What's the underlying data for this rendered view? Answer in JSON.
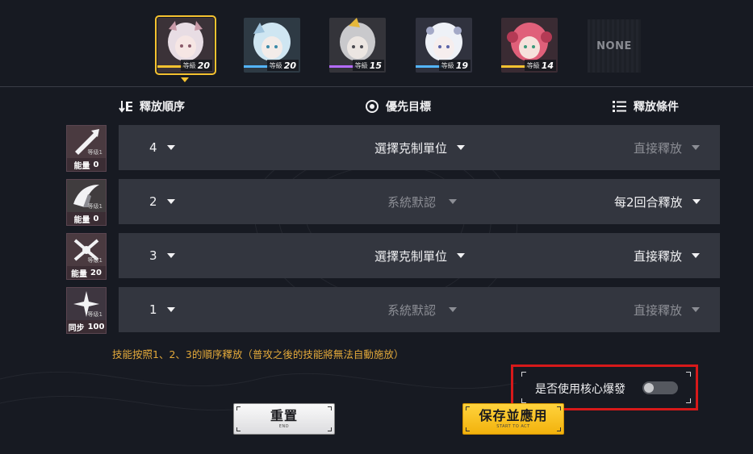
{
  "characters": [
    {
      "level_label": "等級",
      "level": "20",
      "selected": true,
      "hair": "#e8dde4",
      "accent": "#c99aa8",
      "stripe": "#f6c230"
    },
    {
      "level_label": "等級",
      "level": "20",
      "selected": false,
      "hair": "#cfe6f2",
      "accent": "#9fc3dc",
      "stripe": "#53b5ff"
    },
    {
      "level_label": "等級",
      "level": "15",
      "selected": false,
      "hair": "#c9c9cc",
      "accent": "#8c8c93",
      "stripe": "#b46cff"
    },
    {
      "level_label": "等級",
      "level": "19",
      "selected": false,
      "hair": "#eef1f7",
      "accent": "#a3a9c7",
      "stripe": "#53b5ff"
    },
    {
      "level_label": "等級",
      "level": "14",
      "selected": false,
      "hair": "#e0607a",
      "accent": "#b43a55",
      "stripe": "#f6c230"
    }
  ],
  "empty_slot_label": "NONE",
  "headers": {
    "order": "釋放順序",
    "target": "優先目標",
    "condition": "釋放條件"
  },
  "skills": [
    {
      "cost_label": "能量",
      "cost_value": "0",
      "badge": "等级1",
      "order": "4",
      "target": "選擇克制單位",
      "target_active": true,
      "condition": "直接釋放",
      "condition_active": false,
      "tint": "#4a3a40"
    },
    {
      "cost_label": "能量",
      "cost_value": "0",
      "badge": "等级1",
      "order": "2",
      "target": "系統默認",
      "target_active": false,
      "condition": "每2回合釋放",
      "condition_active": true,
      "tint": "#403c3e"
    },
    {
      "cost_label": "能量",
      "cost_value": "20",
      "badge": "等级1",
      "order": "3",
      "target": "選擇克制單位",
      "target_active": true,
      "condition": "直接釋放",
      "condition_active": true,
      "tint": "#4a3a40"
    },
    {
      "cost_label": "同步",
      "cost_value": "100",
      "badge": "等级1",
      "order": "1",
      "target": "系統默認",
      "target_active": false,
      "condition": "直接釋放",
      "condition_active": false,
      "tint": "#3e3640"
    }
  ],
  "hint": "技能按照1、2、3的順序釋放（普攻之後的技能將無法自動施放）",
  "core_burst": {
    "label": "是否使用核心爆發",
    "enabled": false
  },
  "buttons": {
    "reset": {
      "label": "重置",
      "sub": "END"
    },
    "save": {
      "label": "保存並應用",
      "sub": "START TO ACT"
    }
  },
  "colors": {
    "accent": "#f6c230",
    "highlight_box": "#d7191a",
    "hint": "#e3a93a"
  }
}
